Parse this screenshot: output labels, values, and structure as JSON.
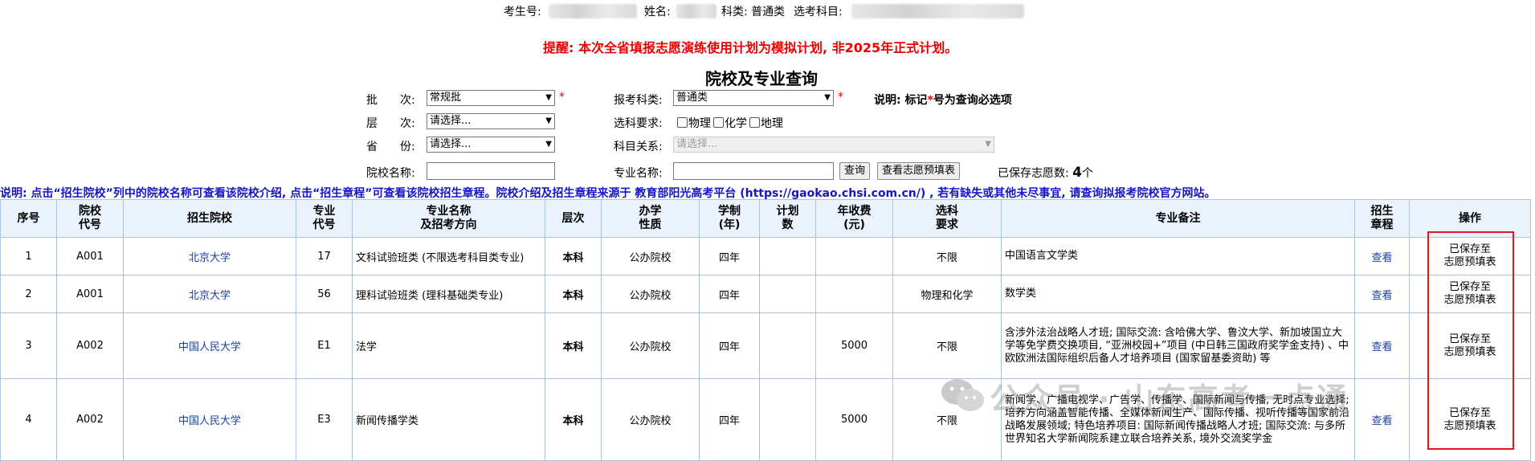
{
  "student_info": {
    "id_label": "考生号:",
    "name_label": "姓名:",
    "category": "科类: 普通类",
    "subjects_label": "选考科目:"
  },
  "warning": "提醒: 本次全省填报志愿演练使用计划为模拟计划, 非2025年正式计划。",
  "page_title": "院校及专业查询",
  "form": {
    "batch_label": "批　　次:",
    "batch_value": "常规批",
    "level_label": "层　　次:",
    "level_value": "请选择...",
    "province_label": "省　　份:",
    "province_value": "请选择...",
    "school_name_label": "院校名称:",
    "exam_category_label": "报考科类:",
    "exam_category_value": "普通类",
    "subject_req_label": "选科要求:",
    "subject_options": [
      "物理",
      "化学",
      "地理"
    ],
    "subject_relation_label": "科目关系:",
    "subject_relation_value": "请选择...",
    "major_name_label": "专业名称:",
    "search_button": "查询",
    "view_table_button": "查看志愿预填表",
    "explain_label": "说明: 标记",
    "explain_star": "*",
    "explain_suffix": "号为查询必选项",
    "saved_count_label": "已保存志愿数:",
    "saved_count_value": "4",
    "saved_count_unit": "个",
    "required_mark": "*"
  },
  "note": "说明: 点击“招生院校”列中的院校名称可查看该院校介绍, 点击“招生章程”可查看该院校招生章程。院校介绍及招生章程来源于 教育部阳光高考平台 (https://gaokao.chsi.com.cn/) , 若有缺失或其他未尽事宜, 请查询拟报考院校官方网站。",
  "table": {
    "headers": [
      "序号",
      "院校\n代号",
      "招生院校",
      "专业\n代号",
      "专业名称\n及招考方向",
      "层次",
      "办学\n性质",
      "学制\n(年)",
      "计划\n数",
      "年收费\n(元)",
      "选科\n要求",
      "专业备注",
      "招生\n章程",
      "操作"
    ],
    "rows": [
      {
        "no": "1",
        "code": "A001",
        "school": "北京大学",
        "major_code": "17",
        "major": "文科试验班类 (不限选考科目类专业)",
        "level": "本科",
        "nature": "公办院校",
        "years": "四年",
        "plan": "",
        "fee": "",
        "req": "不限",
        "remark": "中国语言文学类",
        "charter": "查看",
        "action": "已保存至\n志愿预填表"
      },
      {
        "no": "2",
        "code": "A001",
        "school": "北京大学",
        "major_code": "56",
        "major": "理科试验班类 (理科基础类专业)",
        "level": "本科",
        "nature": "公办院校",
        "years": "四年",
        "plan": "",
        "fee": "",
        "req": "物理和化学",
        "remark": "数学类",
        "charter": "查看",
        "action": "已保存至\n志愿预填表"
      },
      {
        "no": "3",
        "code": "A002",
        "school": "中国人民大学",
        "major_code": "E1",
        "major": "法学",
        "level": "本科",
        "nature": "公办院校",
        "years": "四年",
        "plan": "",
        "fee": "5000",
        "req": "不限",
        "remark": "含涉外法治战略人才班; 国际交流: 含哈佛大学、鲁汶大学、新加坡国立大学等免学费交换项目, “亚洲校园+”项目 (中日韩三国政府奖学金支持) 、中欧欧洲法国际组织后备人才培养项目 (国家留基委资助) 等",
        "charter": "查看",
        "action": "已保存至\n志愿预填表"
      },
      {
        "no": "4",
        "code": "A002",
        "school": "中国人民大学",
        "major_code": "E3",
        "major": "新闻传播学类",
        "level": "本科",
        "nature": "公办院校",
        "years": "四年",
        "plan": "",
        "fee": "5000",
        "req": "不限",
        "remark": "新闻学、广播电视学、广告学、传播学、国际新闻与传播, 无时点专业选择; 培养方向涵盖智能传播、全媒体新闻生产、国际传播、视听传播等国家前沿战略发展领域; 特色培养项目: 国际新闻传播战略人才班; 国际交流: 与多所世界知名大学新闻院系建立联合培养关系, 境外交流奖学金",
        "charter": "查看",
        "action": "已保存至\n志愿预填表"
      }
    ]
  },
  "watermark": "公众号 · 山东高考一点通",
  "colors": {
    "warning": "#ee0000",
    "note": "#1515c8",
    "link": "#1a3fa0",
    "header_bg": "#eaf2fb",
    "border": "#a9c3df",
    "highlight_box": "#e01818"
  }
}
